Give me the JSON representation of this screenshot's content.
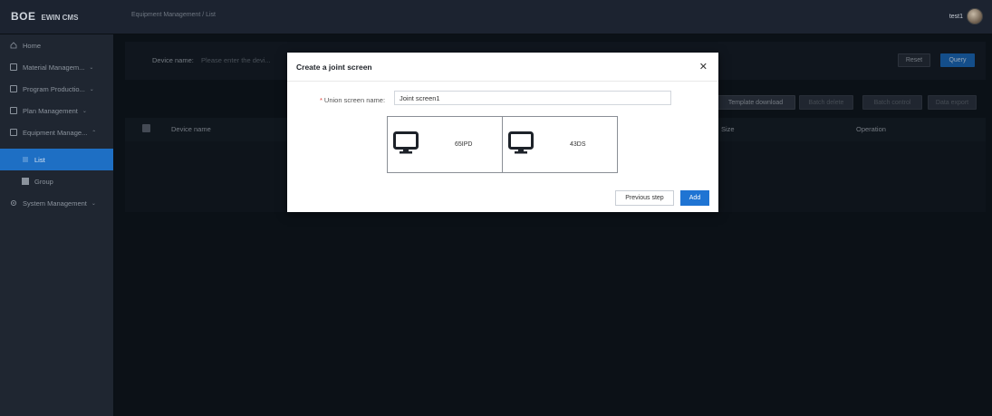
{
  "header": {
    "brand": "BOE",
    "app_name": "EWIN CMS",
    "breadcrumb": "Equipment Management / List",
    "username": "test1"
  },
  "sidebar": {
    "items": [
      {
        "label": "Home",
        "icon": "home-icon"
      },
      {
        "label": "Material Managem...",
        "icon": "material-icon"
      },
      {
        "label": "Program Productio...",
        "icon": "program-icon"
      },
      {
        "label": "Plan Management",
        "icon": "plan-icon"
      },
      {
        "label": "Equipment Manage...",
        "icon": "equipment-icon"
      },
      {
        "label": "List",
        "icon": "list-icon",
        "active": true
      },
      {
        "label": "Group",
        "icon": "group-icon"
      },
      {
        "label": "System Management",
        "icon": "gear-icon"
      }
    ]
  },
  "search": {
    "label": "Device name:",
    "placeholder": "Please enter the devi...",
    "reset_label": "Reset",
    "query_label": "Query"
  },
  "toolbar": {
    "template_download": "Template download",
    "batch_delete": "Batch delete",
    "batch_control": "Batch control",
    "data_export": "Data export"
  },
  "table": {
    "columns": [
      "Device name",
      "Size",
      "Operation"
    ]
  },
  "modal": {
    "title": "Create a joint screen",
    "field_label": "Union screen name:",
    "field_value": "Joint screen1",
    "screens": [
      "65IPD",
      "43DS"
    ],
    "prev_label": "Previous step",
    "add_label": "Add"
  },
  "colors": {
    "accent": "#1f74d3",
    "sidebar_active": "#1e6fc4",
    "background": "#0e141b"
  }
}
